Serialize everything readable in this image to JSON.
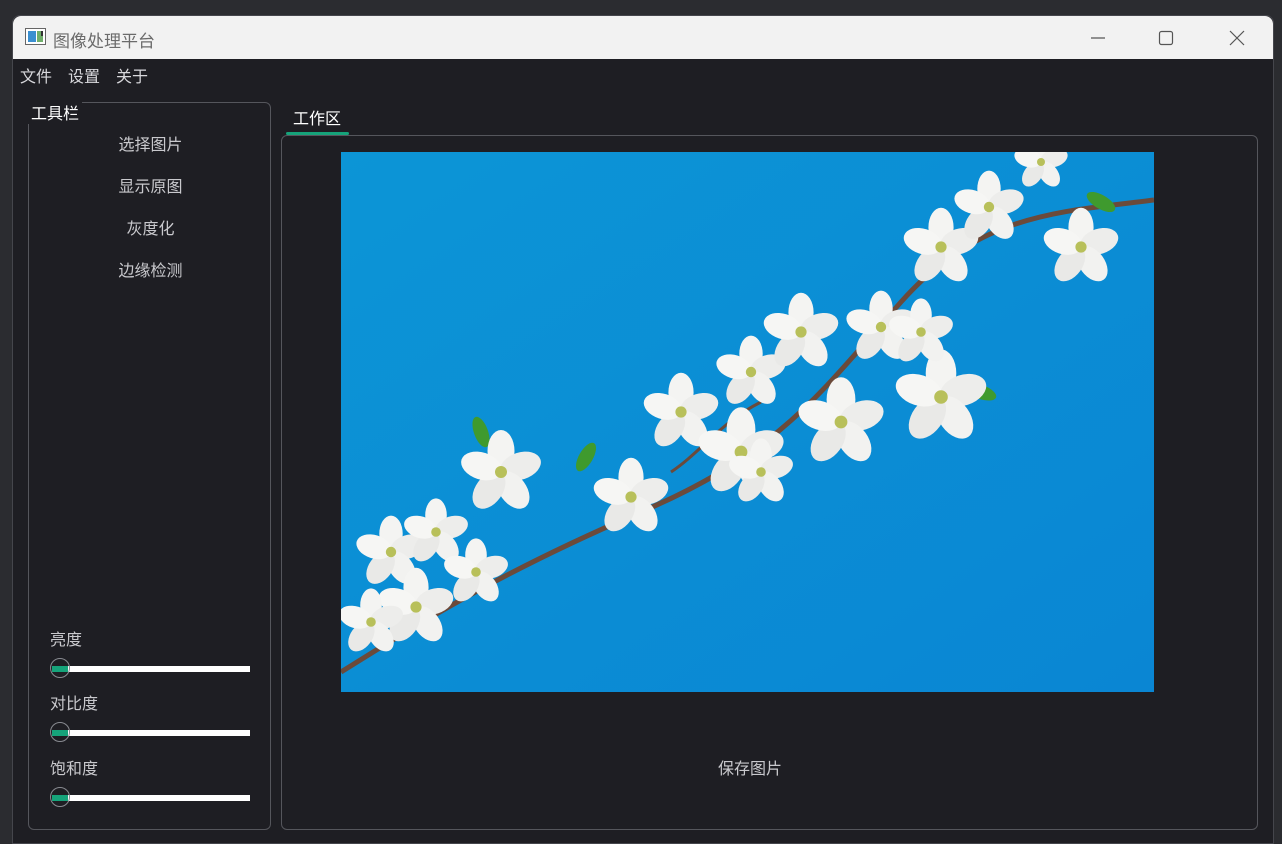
{
  "window": {
    "title": "图像处理平台",
    "controls": [
      "minimize-icon",
      "maximize-icon",
      "close-icon"
    ]
  },
  "menu": {
    "items": [
      {
        "label": "文件"
      },
      {
        "label": "设置"
      },
      {
        "label": "关于"
      }
    ]
  },
  "toolbar": {
    "title": "工具栏",
    "buttons": [
      {
        "label": "选择图片"
      },
      {
        "label": "显示原图"
      },
      {
        "label": "灰度化"
      },
      {
        "label": "边缘检测"
      }
    ],
    "sliders": [
      {
        "label": "亮度",
        "value_fraction": 0.03
      },
      {
        "label": "对比度",
        "value_fraction": 0.03
      },
      {
        "label": "饱和度",
        "value_fraction": 0.03
      }
    ]
  },
  "workspace": {
    "tab_label": "工作区",
    "image_icon": "cherry-blossom-photo",
    "save_label": "保存图片"
  },
  "colors": {
    "accent": "#16a37a",
    "background": "#1e1e23",
    "sky": "#0a8fd4"
  }
}
